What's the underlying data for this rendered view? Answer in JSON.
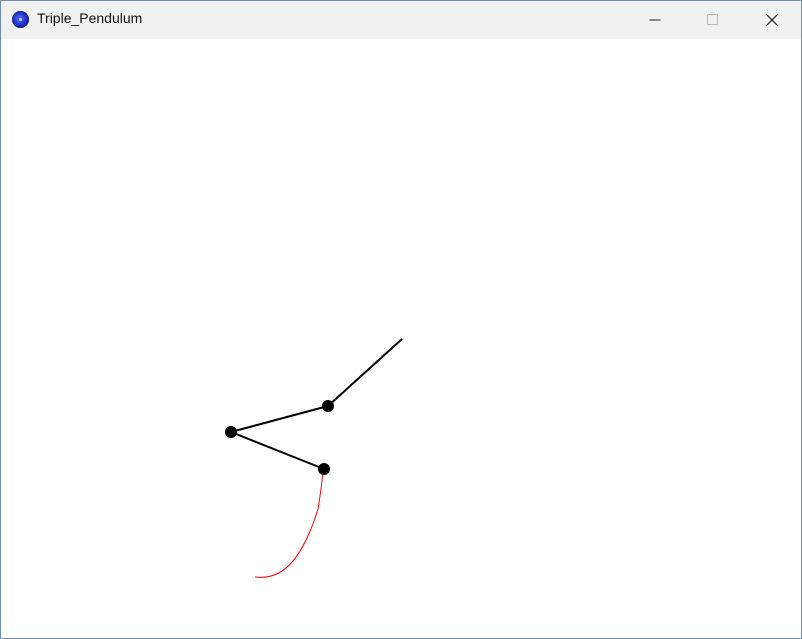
{
  "window": {
    "title": "Triple_Pendulum",
    "icon": "app-icon"
  },
  "controls": {
    "minimize_icon": "minimize-icon",
    "maximize_icon": "maximize-icon",
    "close_icon": "close-icon"
  },
  "colors": {
    "titlebar_bg": "#f1f1f1",
    "canvas_bg": "#ffffff",
    "rod": "#000000",
    "bob": "#000000",
    "trail": "#ff0000"
  }
}
